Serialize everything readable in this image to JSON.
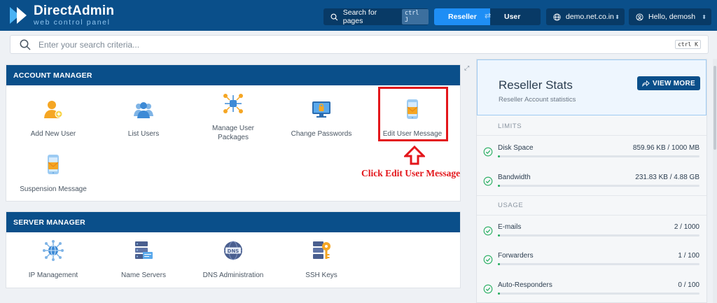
{
  "header": {
    "brand": "DirectAdmin",
    "tagline": "web control panel",
    "search_label": "Search for pages",
    "search_shortcut": "ctrl J",
    "role_active": "Reseller",
    "role_other": "User",
    "domain": "demo.net.co.in",
    "greeting": "Hello, demosh"
  },
  "search": {
    "placeholder": "Enter your search criteria...",
    "shortcut": "ctrl K"
  },
  "account_manager": {
    "title": "ACCOUNT MANAGER",
    "items": [
      {
        "label": "Add New User",
        "icon": "add-user-icon"
      },
      {
        "label": "List Users",
        "icon": "users-group-icon"
      },
      {
        "label": "Manage User Packages",
        "icon": "network-nodes-icon"
      },
      {
        "label": "Change Passwords",
        "icon": "monitor-lock-icon"
      },
      {
        "label": "Edit User Message",
        "icon": "phone-message-icon"
      },
      {
        "label": "Suspension Message",
        "icon": "phone-message-icon"
      }
    ]
  },
  "server_manager": {
    "title": "SERVER MANAGER",
    "items": [
      {
        "label": "IP Management",
        "icon": "globe-network-icon"
      },
      {
        "label": "Name Servers",
        "icon": "server-stack-icon"
      },
      {
        "label": "DNS Administration",
        "icon": "dns-globe-icon"
      },
      {
        "label": "SSH Keys",
        "icon": "key-server-icon"
      }
    ]
  },
  "annotation": {
    "text": "Click Edit User Message"
  },
  "stats": {
    "title": "Reseller Stats",
    "subtitle": "Reseller Account statistics",
    "view_more": "VIEW MORE",
    "limits_label": "LIMITS",
    "usage_label": "USAGE",
    "limits": [
      {
        "name": "Disk Space",
        "value": "859.96 KB / 1000 MB",
        "fraction": 0.001
      },
      {
        "name": "Bandwidth",
        "value": "231.83 KB / 4.88 GB",
        "fraction": 0.0001
      }
    ],
    "usage": [
      {
        "name": "E-mails",
        "value": "2 / 1000",
        "fraction": 0.002
      },
      {
        "name": "Forwarders",
        "value": "1 / 100",
        "fraction": 0.01
      },
      {
        "name": "Auto-Responders",
        "value": "0 / 100",
        "fraction": 0
      }
    ]
  },
  "colors": {
    "brand": "#0a4f8a",
    "accent": "#1e8ef5",
    "success": "#27ae60",
    "highlight": "#e3161b"
  }
}
